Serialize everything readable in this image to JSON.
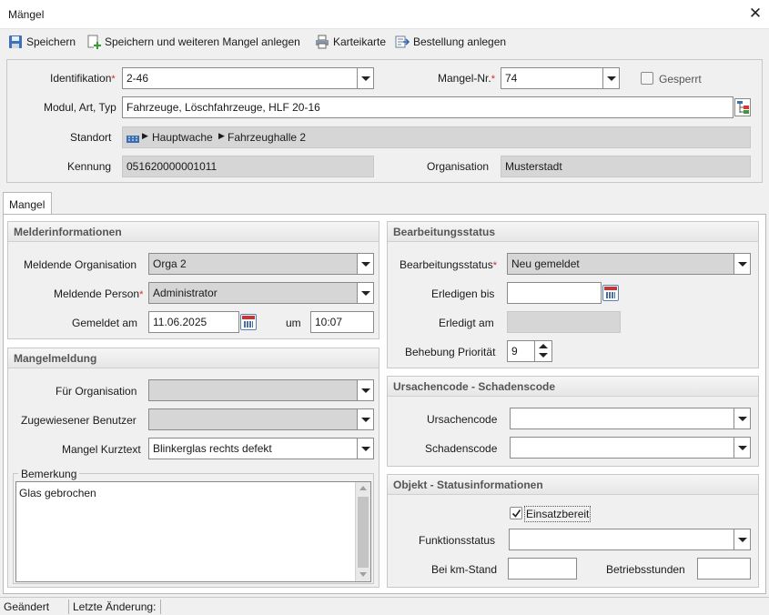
{
  "window": {
    "title": "Mängel",
    "close_glyph": "✕"
  },
  "toolbar": {
    "save": "Speichern",
    "save_new": "Speichern und weiteren Mangel anlegen",
    "card": "Karteikarte",
    "order": "Bestellung anlegen"
  },
  "header": {
    "ident_label": "Identifikation",
    "ident_value": "2-46",
    "mangel_nr_label": "Mangel-Nr.",
    "mangel_nr_value": "74",
    "locked_label": "Gesperrt",
    "locked_checked": false,
    "modul_label": "Modul, Art, Typ",
    "modul_value": "Fahrzeuge, Löschfahrzeuge, HLF 20-16",
    "standort_label": "Standort",
    "standort_path": [
      "Hauptwache",
      "Fahrzeughalle 2"
    ],
    "kennung_label": "Kennung",
    "kennung_value": "051620000001011",
    "org_label": "Organisation",
    "org_value": "Musterstadt",
    "required_mark": "*"
  },
  "tabs": [
    {
      "label": "Mangel",
      "active": true
    }
  ],
  "melder": {
    "title": "Melderinformationen",
    "org_label": "Meldende Organisation",
    "org_value": "Orga 2",
    "person_label": "Meldende Person",
    "person_value": "Administrator",
    "date_label": "Gemeldet am",
    "date_value": "11.06.2025",
    "time_label": "um",
    "time_value": "10:07"
  },
  "mangel": {
    "title": "Mangelmeldung",
    "for_org_label": "Für Organisation",
    "for_org_value": "",
    "user_label": "Zugewiesener Benutzer",
    "user_value": "",
    "short_label": "Mangel Kurztext",
    "short_value": "Blinkerglas rechts defekt",
    "remark_label": "Bemerkung",
    "remark_value": "Glas gebrochen"
  },
  "status": {
    "title": "Bearbeitungsstatus",
    "status_label": "Bearbeitungsstatus",
    "status_value": "Neu gemeldet",
    "due_label": "Erledigen bis",
    "due_value": "",
    "done_label": "Erledigt am",
    "done_value": "",
    "priority_label": "Behebung Priorität",
    "priority_value": "9"
  },
  "codes": {
    "title": "Ursachencode - Schadenscode",
    "cause_label": "Ursachencode",
    "cause_value": "",
    "damage_label": "Schadenscode",
    "damage_value": ""
  },
  "objekt": {
    "title": "Objekt - Statusinformationen",
    "ready_label": "Einsatzbereit",
    "ready_checked": true,
    "func_label": "Funktionsstatus",
    "func_value": "",
    "km_label": "Bei km-Stand",
    "km_value": "",
    "hours_label": "Betriebsstunden",
    "hours_value": ""
  },
  "statusbar": {
    "changed": "Geändert",
    "last_change": "Letzte Änderung:"
  },
  "colors": {
    "required": "#d62a2a",
    "readonly_bg": "#d6d6d6",
    "panel_bg": "#f0f0f0"
  }
}
